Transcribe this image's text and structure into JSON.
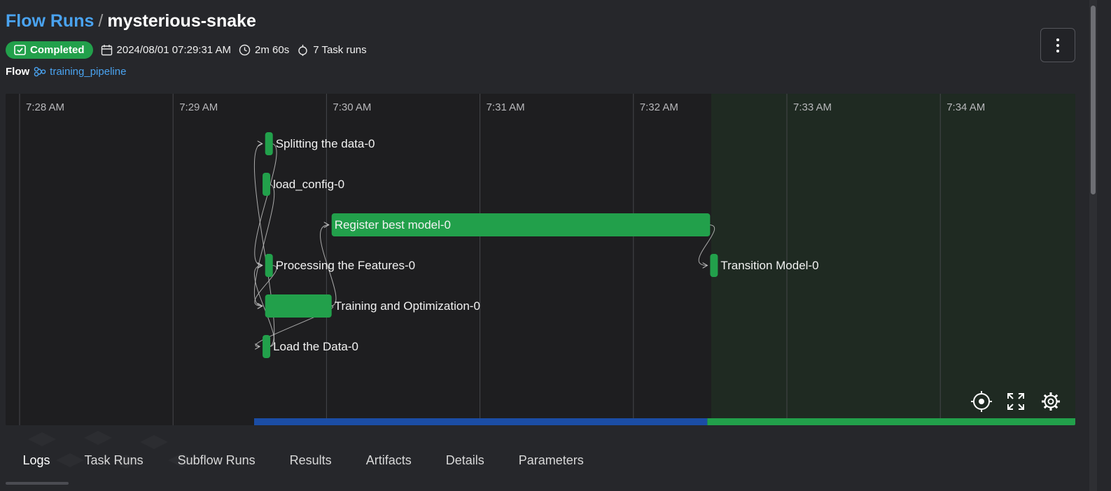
{
  "breadcrumb": {
    "root": "Flow Runs",
    "separator": "/",
    "current": "mysterious-snake"
  },
  "status": {
    "label": "Completed",
    "color": "#22a04b"
  },
  "meta": {
    "start": "2024/08/01 07:29:31 AM",
    "duration": "2m 60s",
    "task_runs": "7 Task runs"
  },
  "flow": {
    "label": "Flow",
    "name": "training_pipeline"
  },
  "timeline": {
    "ticks": [
      "7:28 AM",
      "7:29 AM",
      "7:30 AM",
      "7:31 AM",
      "7:32 AM",
      "7:33 AM",
      "7:34 AM"
    ],
    "bar_color": "#22a04b",
    "tasks": [
      {
        "name": "Splitting the data-0",
        "start": "7:29:36",
        "end": "7:29:38",
        "row": 0
      },
      {
        "name": "load_config-0",
        "start": "7:29:35",
        "end": "7:29:37",
        "row": 1
      },
      {
        "name": "Register best model-0",
        "start": "7:30:02",
        "end": "7:32:30",
        "row": 2
      },
      {
        "name": "Processing the Features-0",
        "start": "7:29:36",
        "end": "7:29:38",
        "row": 3
      },
      {
        "name": "Transition Model-0",
        "start": "7:32:30",
        "end": "7:32:32",
        "row": 3
      },
      {
        "name": "Training and Optimization-0",
        "start": "7:29:36",
        "end": "7:30:02",
        "row": 4
      },
      {
        "name": "Load the Data-0",
        "start": "7:29:35",
        "end": "7:29:37",
        "row": 5
      }
    ],
    "progress": {
      "running_color": "#1b4da5",
      "done_color": "#22a04b"
    }
  },
  "controls": {
    "recenter": "crosshair-icon",
    "fullscreen": "expand-icon",
    "settings": "gear-icon"
  },
  "tabs": [
    "Logs",
    "Task Runs",
    "Subflow Runs",
    "Results",
    "Artifacts",
    "Details",
    "Parameters"
  ],
  "active_tab": "Logs"
}
